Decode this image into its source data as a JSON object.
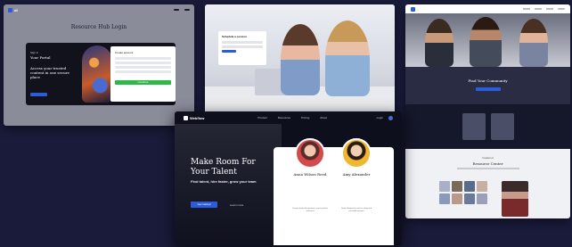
{
  "colors": {
    "background": "#1a1b3a",
    "accent": "#2b5cd9",
    "success": "#2fb84a",
    "dark_panel": "#11121c"
  },
  "card1": {
    "nav": {
      "logo": "dt",
      "links": [
        "",
        ""
      ],
      "buttons": [
        "",
        ""
      ]
    },
    "heading": "Resource Hub Login",
    "panel": {
      "kicker": "Sign in",
      "title": "Your Portal",
      "body": "Access your trusted content in one secure place"
    },
    "form": {
      "title": "Create account",
      "submit": "Continue"
    }
  },
  "card2": {
    "callout_title": "Schedule a session"
  },
  "card3": {
    "band_title": "Find Your Community",
    "lower_kicker": "Featured",
    "lower_title": "Resource Center"
  },
  "card4": {
    "nav": {
      "logo": "Webflow",
      "links": [
        "Product",
        "Resources",
        "Pricing",
        "About"
      ],
      "right": [
        "Login"
      ]
    },
    "headline": "Make Room For Your Talent",
    "overlay": "Find talent, hire faster, grow your team",
    "cta": "Get started",
    "secondary_link": "Learn more",
    "profiles": [
      {
        "name": "Anna Wilson Reed",
        "desc": "Creative lead with experience across product and brand"
      },
      {
        "name": "Amy Alexander",
        "desc": "Senior designer focused on clarity and accessible systems"
      }
    ]
  }
}
